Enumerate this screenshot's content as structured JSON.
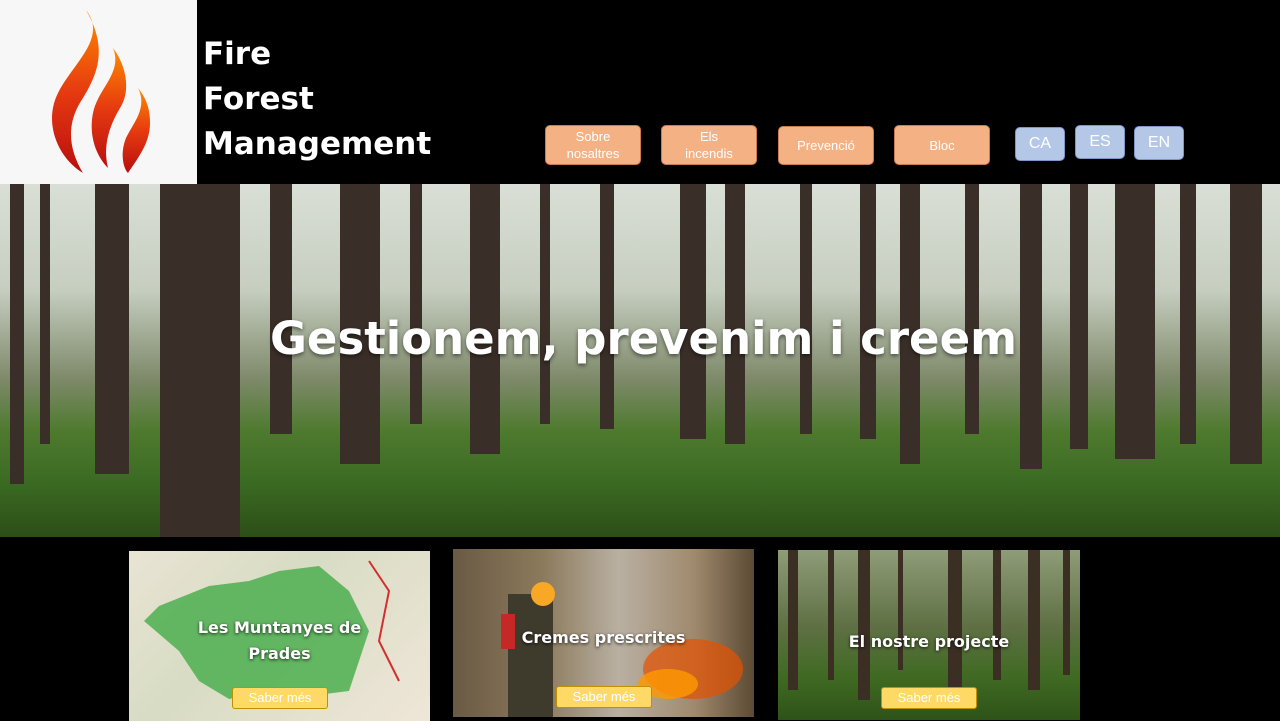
{
  "brand": {
    "line1": "Fire",
    "line2": "Forest",
    "line3": "Management",
    "logo_icon": "flame-icon"
  },
  "nav": {
    "items": [
      {
        "label": "Sobre nosaltres"
      },
      {
        "label": "Els incendis"
      },
      {
        "label": "Prevenció"
      },
      {
        "label": "Bloc"
      }
    ]
  },
  "languages": [
    "CA",
    "ES",
    "EN"
  ],
  "hero": {
    "title": "Gestionem, prevenim i creem"
  },
  "cards": [
    {
      "title": "Les Muntanyes de Prades",
      "button": "Saber més"
    },
    {
      "title": "Cremes prescrites",
      "button": "Saber més"
    },
    {
      "title": "El nostre projecte",
      "button": "Saber més"
    }
  ],
  "colors": {
    "nav_button": "#f4b183",
    "lang_button": "#b4c7e7",
    "card_button": "#ffd966",
    "header_bg": "#000000"
  }
}
